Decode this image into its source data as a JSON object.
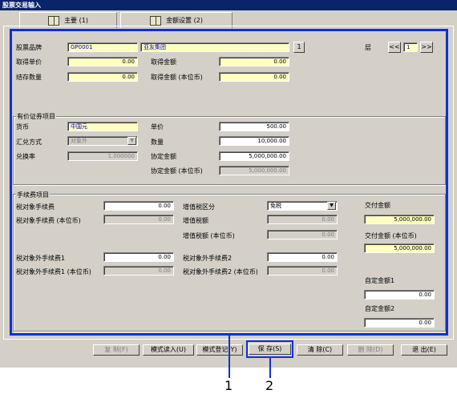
{
  "window": {
    "title": "股票交易输入"
  },
  "tabs": [
    {
      "label": "主要 (1)"
    },
    {
      "label": "金额设置 (2)"
    }
  ],
  "top": {
    "stock_code_label": "股票品牌",
    "stock_code": "GP0001",
    "stock_name": "亚友集团",
    "lookup_btn": "1",
    "layer_label": "层",
    "prev_btn": "<<",
    "layer_value": "1",
    "next_btn": ">>",
    "unit_price_label": "取得单价",
    "unit_price": "0.00",
    "amount_label": "取得金额",
    "amount": "0.00",
    "quantity_label": "结存数量",
    "quantity": "0.00",
    "amount_local_label": "取得金额 (本位币)",
    "amount_local": "0.00"
  },
  "securities": {
    "group_label": "有价证券项目",
    "currency_label": "货币",
    "currency": "中国元",
    "exchange_method_label": "汇兑方式",
    "exchange_method": "对象外",
    "rate_label": "兑换率",
    "rate": "1.000000",
    "price_label": "单价",
    "price": "500.00",
    "qty_label": "数量",
    "qty": "10,000.00",
    "agreed_label": "协定金额",
    "agreed": "5,000,000.00",
    "agreed_local_label": "协定金额 (本位币)",
    "agreed_local": "5,000,000.00"
  },
  "fees": {
    "group_label": "手续费项目",
    "tax_fee_label": "税对象手续费",
    "tax_fee": "0.00",
    "tax_fee_local_label": "税对象手续费 (本位币)",
    "tax_fee_local": "0.00",
    "vat_type_label": "增值税区分",
    "vat_type": "免税",
    "vat_amount_label": "增值税额",
    "vat_amount": "0.00",
    "vat_local_label": "增值税额 (本位币)",
    "vat_local": "0.00",
    "nontax_fee1_label": "税对象外手续费1",
    "nontax_fee1": "0.00",
    "nontax_fee1_local_label": "税对象外手续费1 (本位币)",
    "nontax_fee1_local": "0.00",
    "nontax_fee2_label": "税对象外手续费2",
    "nontax_fee2": "0.00",
    "nontax_fee2_local_label": "税对象外手续费2 (本位币)",
    "nontax_fee2_local": "0.00",
    "delivery_label": "交付金额",
    "delivery": "5,000,000.00",
    "delivery_local_label": "交付金额 (本位币)",
    "delivery_local": "5,000,000.00",
    "custom1_label": "自定金额1",
    "custom1": "0.00",
    "custom2_label": "自定金额2",
    "custom2": "0.00"
  },
  "buttons": {
    "copy": "复 制(F)",
    "mode_load": "模式读入(U)",
    "mode_register": "模式登记(Y)",
    "save": "保 存(S)",
    "clear": "清 除(C)",
    "delete": "删 除(D)",
    "exit": "退 出(E)"
  },
  "callouts": {
    "one": "1",
    "two": "2"
  },
  "colors": {
    "accent": "#1030d0",
    "titlebar": "#0a246a",
    "input_yellow": "#ffffc0",
    "dialog": "#d4d0c8"
  }
}
